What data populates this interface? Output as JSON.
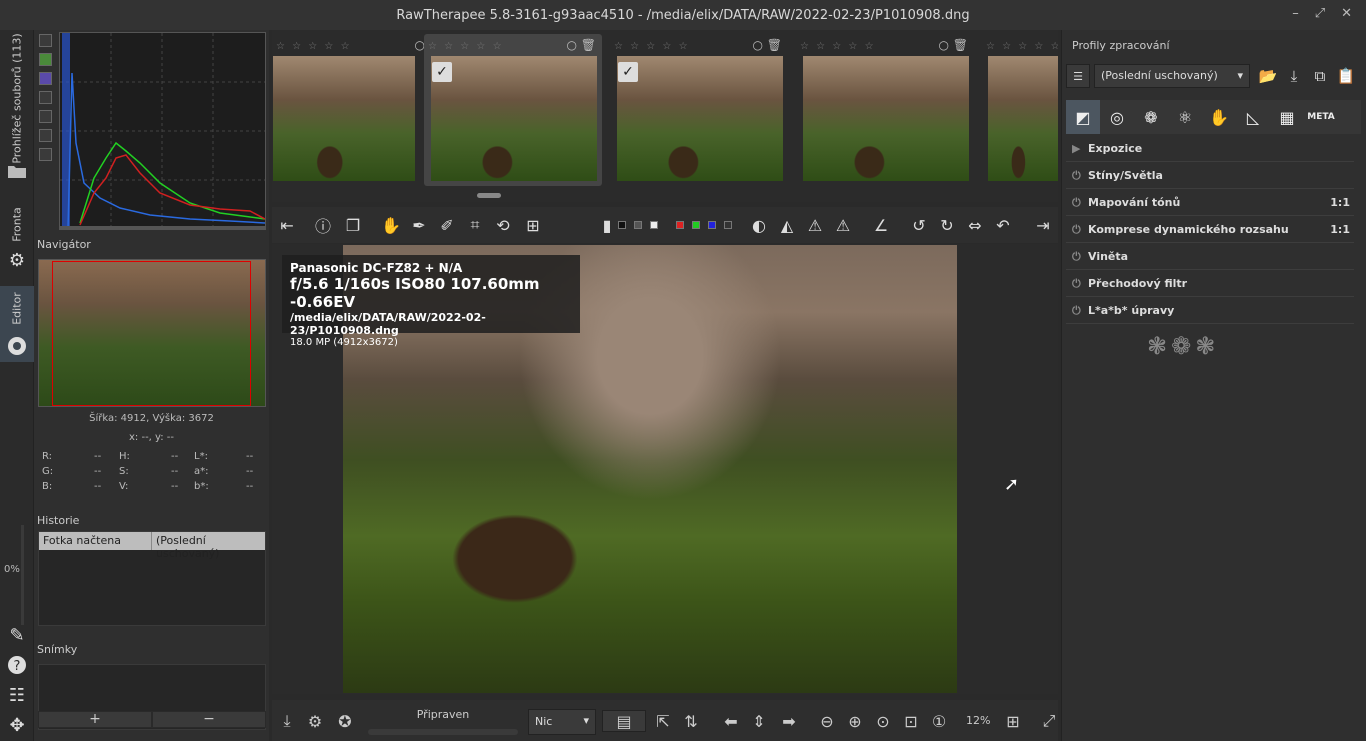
{
  "window": {
    "title": "RawTherapee 5.8-3161-g93aac4510 - /media/elix/DATA/RAW/2022-02-23/P1010908.dng",
    "buttons": [
      "–",
      "⤢",
      "✕"
    ]
  },
  "left_tabs": {
    "file_browser": "Prohlížeč souborů (113)",
    "queue": "Fronta",
    "editor": "Editor"
  },
  "navigator": {
    "title": "Navigátor",
    "dimensions": "Šířka: 4912, Výška: 3672",
    "coords": "x: --, y: --",
    "values": [
      {
        "k": "R:",
        "v": "--"
      },
      {
        "k": "H:",
        "v": "--"
      },
      {
        "k": "L*:",
        "v": "--"
      },
      {
        "k": "G:",
        "v": "--"
      },
      {
        "k": "S:",
        "v": "--"
      },
      {
        "k": "a*:",
        "v": "--"
      },
      {
        "k": "B:",
        "v": "--"
      },
      {
        "k": "V:",
        "v": "--"
      },
      {
        "k": "b*:",
        "v": "--"
      }
    ]
  },
  "history": {
    "title": "Historie",
    "zoom_label": "0%",
    "rows": [
      {
        "action": "Fotka načtena",
        "value": "(Poslední uschovaný)"
      }
    ]
  },
  "snapshots": {
    "title": "Snímky",
    "add": "+",
    "remove": "−"
  },
  "filmstrip": {
    "stars": "☆ ☆ ☆ ☆ ☆",
    "icons": "○ 🗑"
  },
  "image_info": {
    "camera": "Panasonic DC-FZ82 + N/A",
    "exposure": "f/5.6 1/160s ISO80 107.60mm -0.66EV",
    "path": "/media/elix/DATA/RAW/2022-02-23/P1010908.dng",
    "megapixels": "18.0 MP (4912x3672)"
  },
  "bottom": {
    "status": "Připraven",
    "filter": "Nic",
    "zoom": "12%"
  },
  "right_panel": {
    "title": "Profily zpracování",
    "profile": "(Poslední uschovaný)",
    "tools": [
      {
        "name": "Expozice",
        "badge": "",
        "icon": "▶"
      },
      {
        "name": "Stíny/Světla",
        "badge": "",
        "icon": "⏻"
      },
      {
        "name": "Mapování tónů",
        "badge": "1:1",
        "icon": "⏻"
      },
      {
        "name": "Komprese dynamického rozsahu",
        "badge": "1:1",
        "icon": "⏻"
      },
      {
        "name": "Viněta",
        "badge": "",
        "icon": "⏻"
      },
      {
        "name": "Přechodový filtr",
        "badge": "",
        "icon": "⏻"
      },
      {
        "name": "L*a*b* úpravy",
        "badge": "",
        "icon": "⏻"
      }
    ],
    "meta_tab": "META"
  },
  "colors": {
    "background": "#2a2a2a",
    "selection": "#4c5660",
    "histogram_red": "#d02020",
    "histogram_green": "#20d020",
    "histogram_blue": "#2060e0"
  }
}
